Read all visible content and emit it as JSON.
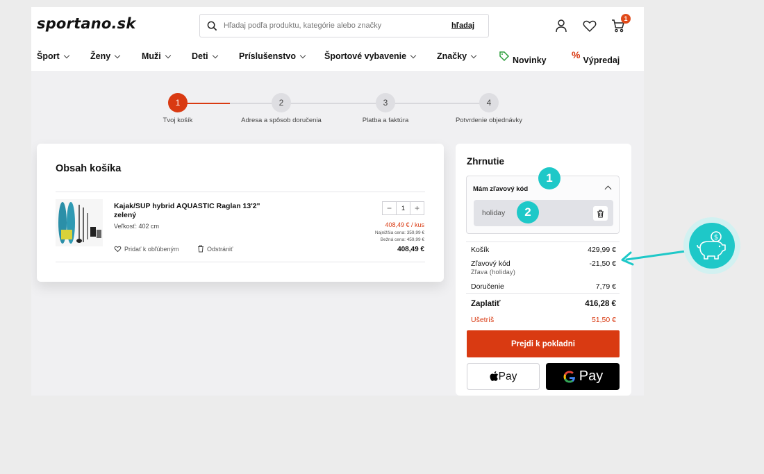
{
  "header": {
    "logo": "sportano.sk",
    "search_placeholder": "Hľadaj podľa produktu, kategórie alebo značky",
    "search_button": "hľadaj",
    "cart_count": "1"
  },
  "nav": [
    {
      "label": "Šport"
    },
    {
      "label": "Ženy"
    },
    {
      "label": "Muži"
    },
    {
      "label": "Deti"
    },
    {
      "label": "Príslušenstvo"
    },
    {
      "label": "Športové vybavenie"
    },
    {
      "label": "Značky"
    },
    {
      "label": "Novinky"
    },
    {
      "label": "Výpredaj"
    }
  ],
  "steps": [
    {
      "num": "1",
      "label": "Tvoj košík"
    },
    {
      "num": "2",
      "label": "Adresa a spôsob doručenia"
    },
    {
      "num": "3",
      "label": "Platba a faktúra"
    },
    {
      "num": "4",
      "label": "Potvrdenie objednávky"
    }
  ],
  "cart": {
    "title": "Obsah košíka",
    "product": {
      "name": "Kajak/SUP hybrid AQUASTIC Raglan 13'2\" zelený",
      "size": "Veľkosť: 402 cm",
      "quantity": "1",
      "unit_price": "408,49 € / kus",
      "lowest_price": "Najnižšia cena: 359,99 €",
      "regular_price": "Bežná cena: 459,99 €",
      "total": "408,49 €",
      "favorite_link": "Pridať k obľúbeným",
      "remove_link": "Odstrániť"
    }
  },
  "summary": {
    "title": "Zhrnutie",
    "coupon_header": "Mám zľavový kód",
    "coupon_value": "holiday",
    "rows": {
      "cart_label": "Košík",
      "cart_value": "429,99 €",
      "discount_label": "Zľavový kód",
      "discount_value": "-21,50 €",
      "discount_sub": "Zľava (holiday)",
      "delivery_label": "Doručenie",
      "delivery_value": "7,79 €",
      "total_label": "Zaplatiť",
      "total_value": "416,28 €",
      "save_label": "Ušetríš",
      "save_value": "51,50 €"
    },
    "checkout_button": "Prejdi k pokladni",
    "apple_pay": "Pay",
    "google_pay": "Pay"
  },
  "annotations": {
    "badge1": "1",
    "badge2": "2"
  },
  "colors": {
    "accent": "#d93a12",
    "teal": "#1ec8c8"
  }
}
